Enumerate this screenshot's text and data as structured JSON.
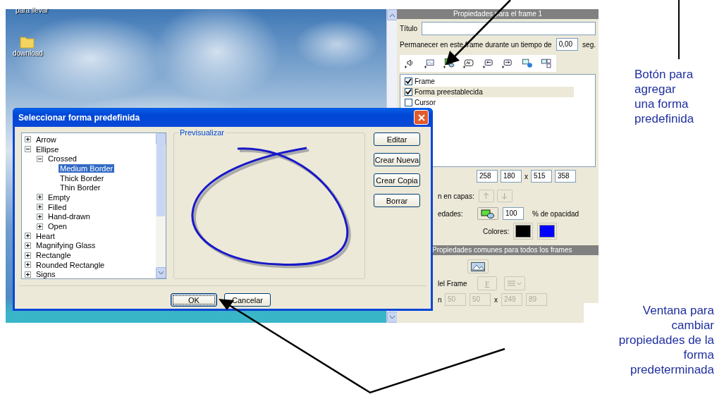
{
  "desktop": {
    "icons": [
      {
        "label": "para llevar"
      },
      {
        "label": "download"
      }
    ]
  },
  "frame_panel": {
    "title": "Propiedades para el frame 1",
    "title_label": "Título",
    "duration_label": "Permanecer en este frame durante un tiempo de",
    "duration_value": "0,00",
    "duration_unit": "seg.",
    "layers": [
      {
        "label": "Frame",
        "checked": true,
        "selected": false
      },
      {
        "label": "Forma preestablecida",
        "checked": true,
        "selected": true
      },
      {
        "label": "Cursor",
        "checked": false,
        "selected": false
      }
    ],
    "position_values": [
      "258",
      "180",
      "515",
      "358"
    ],
    "position_separator": "x",
    "layer_order_label": "n en capas:",
    "layer_order_disabled": true,
    "properties_label": "edades:",
    "opacity_value": "100",
    "opacity_label": "% de opacidad",
    "colors_label": "Colores:",
    "colors": [
      {
        "color": "#000000"
      },
      {
        "color": "#0000ff"
      }
    ]
  },
  "common_panel": {
    "title": "Propiedades comunes para todos los frames",
    "frame_label": "lel Frame",
    "font_button": "F",
    "disabled": true,
    "size_label": "n",
    "size_values": [
      "50",
      "50",
      "249",
      "89"
    ],
    "size_separator": "x"
  },
  "dialog": {
    "title": "Seleccionar forma predefinida",
    "preview_label": "Previsualizar",
    "tree": [
      {
        "label": "Arrow",
        "expanded": false,
        "selected": false
      },
      {
        "label": "Ellipse",
        "expanded": true,
        "selected": false,
        "children": [
          {
            "label": "Crossed",
            "expanded": true,
            "selected": false,
            "children": [
              {
                "label": "Medium Border",
                "selected": true
              },
              {
                "label": "Thick Border",
                "selected": false
              },
              {
                "label": "Thin Border",
                "selected": false
              }
            ]
          },
          {
            "label": "Empty",
            "expanded": false,
            "selected": false
          },
          {
            "label": "Filled",
            "expanded": false,
            "selected": false
          },
          {
            "label": "Hand-drawn",
            "expanded": false,
            "selected": false
          },
          {
            "label": "Open",
            "expanded": false,
            "selected": false
          }
        ]
      },
      {
        "label": "Heart",
        "expanded": false,
        "selected": false
      },
      {
        "label": "Magnifying Glass",
        "expanded": false,
        "selected": false
      },
      {
        "label": "Rectangle",
        "expanded": false,
        "selected": false
      },
      {
        "label": "Rounded Rectangle",
        "expanded": false,
        "selected": false
      },
      {
        "label": "Signs",
        "expanded": false,
        "selected": false
      }
    ],
    "side_buttons": [
      "Editar",
      "Crear Nueva",
      "Crear Copia",
      "Borrar"
    ],
    "ok_button": "OK",
    "cancel_button": "Cancelar"
  },
  "annotations": [
    {
      "text": "Botón para\nagregar\nuna forma\npredefinida"
    },
    {
      "text": "Ventana para\ncambiar\npropiedades de la\nforma\npredeterminada"
    }
  ]
}
